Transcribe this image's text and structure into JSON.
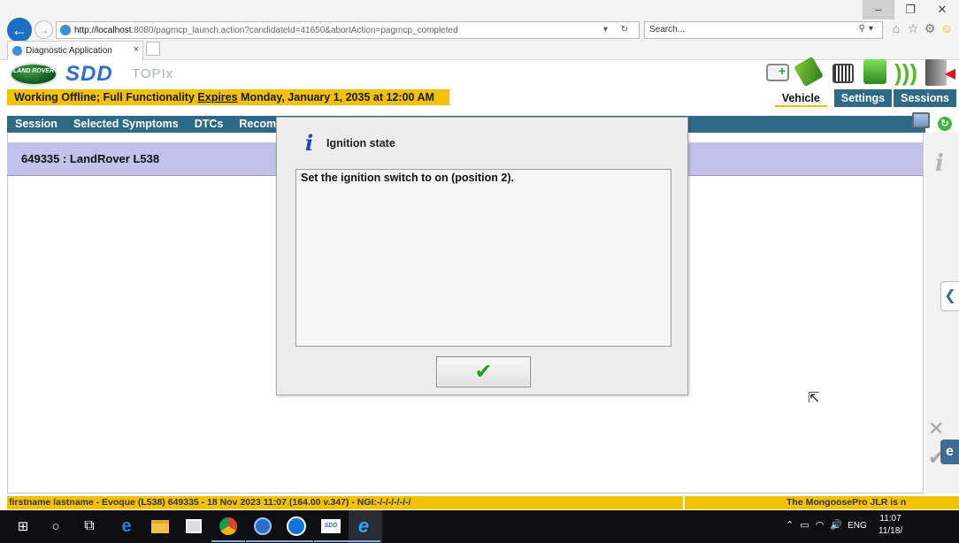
{
  "browser": {
    "address_host": "http://localhost",
    "address_rest": ":8080/pagmcp_launch.action?candidateId=41650&abortAction=pagmcp_completed",
    "search_placeholder": "Search...",
    "tab_title": "Diagnostic Application",
    "tab_close": "×"
  },
  "app": {
    "logo_text": "LAND ROVER",
    "product": "SDD",
    "product_sub": "TOPIx",
    "banner": {
      "prefix": "Working Offline; Full Functionality ",
      "link": "Expires",
      "suffix": " Monday, January 1, 2035 at 12:00 AM"
    },
    "top_nav": [
      "Vehicle",
      "Settings",
      "Sessions"
    ],
    "top_nav_active": "Vehicle",
    "menu": [
      "Session",
      "Selected Symptoms",
      "DTCs",
      "Recom"
    ],
    "vehicle_title": "649335 : LandRover L538",
    "colors": {
      "banner": "#f2c100",
      "menubar": "#2e6a87",
      "vehicle_bar": "#c3c0ea"
    }
  },
  "dialog": {
    "icon": "info-icon",
    "title": "Ignition state",
    "message": "Set the ignition switch to on (position 2).",
    "ok_symbol": "✔"
  },
  "status": {
    "left": "firstname lastname - Evoque (L538) 649335 - 18 Nov 2023 11:07 (164.00 v.347) - NGI:-/-/-/-/-/-/",
    "right": "The MongoosePro JLR is n"
  },
  "taskbar": {
    "lang": "ENG",
    "time": "11:07",
    "date": "11/18/"
  }
}
